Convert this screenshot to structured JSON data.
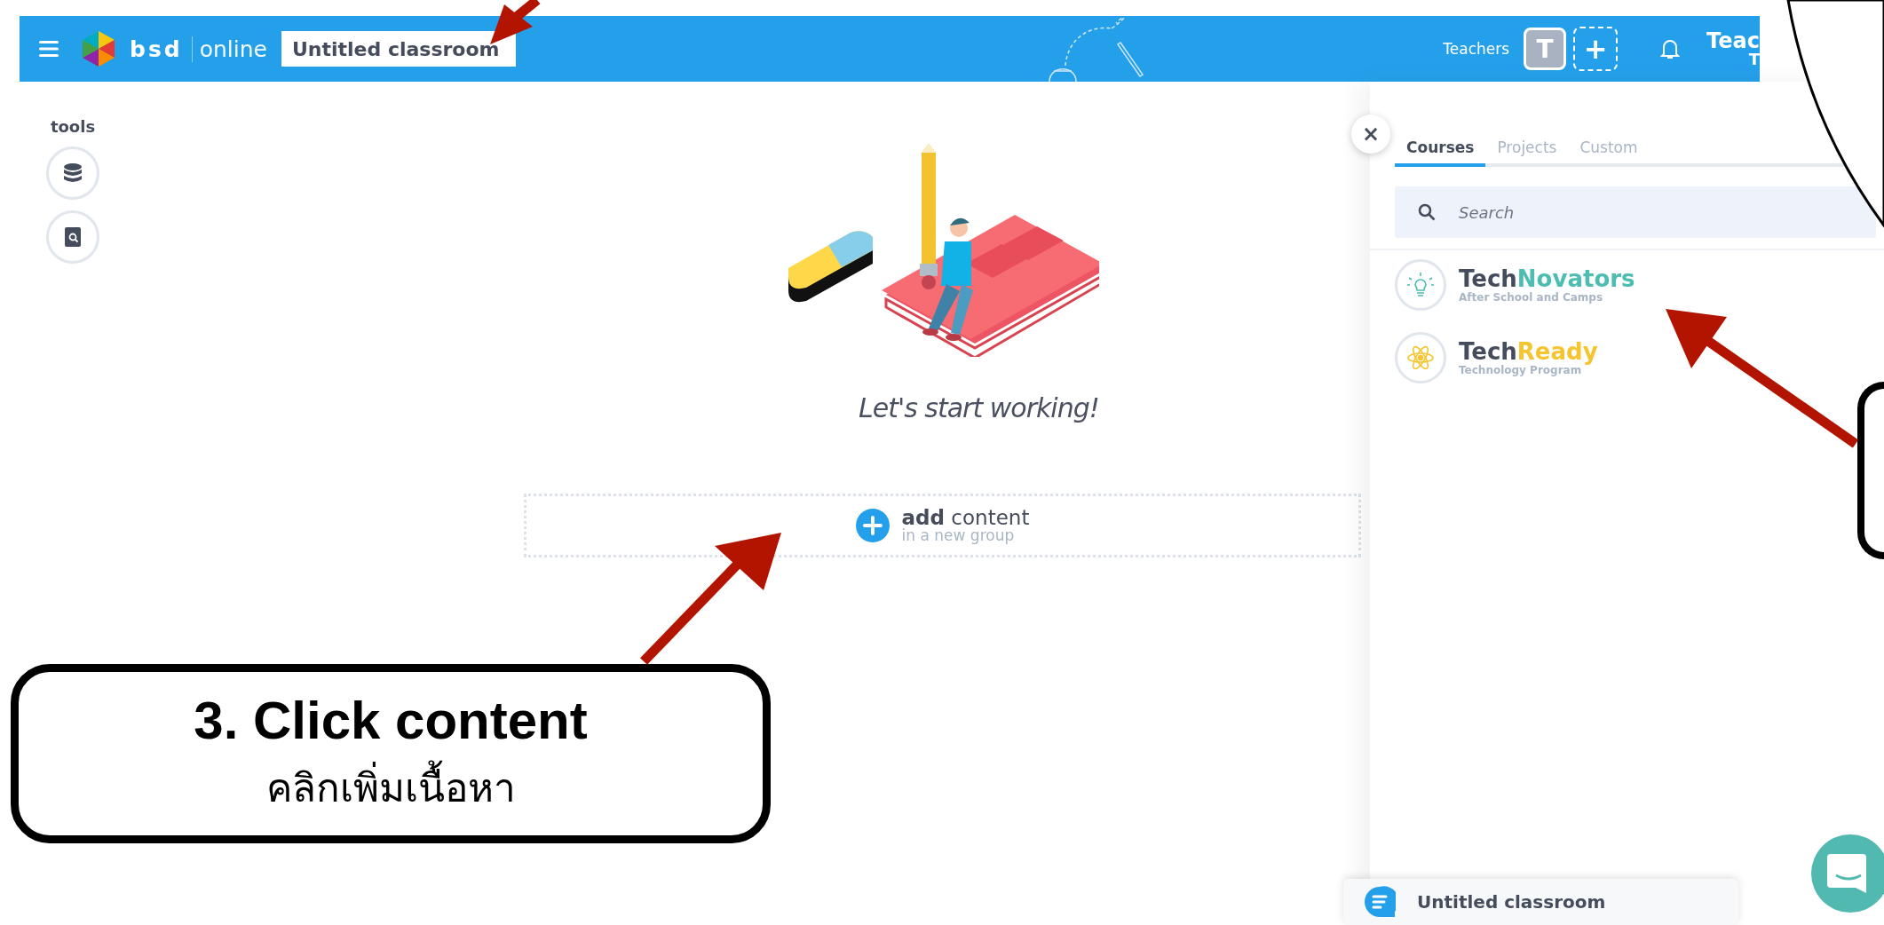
{
  "header": {
    "brand": "bsd",
    "brand_suffix": "online",
    "classroom_title": "Untitled classroom",
    "role_label": "Teachers",
    "avatar_initial": "T",
    "add_symbol": "+",
    "user_name": "Teac",
    "user_sub": "T"
  },
  "tools": {
    "title": "tools"
  },
  "empty_state": {
    "message": "Let's start working!"
  },
  "add_content": {
    "label": "**add** content",
    "sub": "in a new group"
  },
  "panel": {
    "close": "×",
    "tabs": [
      {
        "label": "Courses",
        "selected": true
      },
      {
        "label": "Projects",
        "selected": false
      },
      {
        "label": "Custom",
        "selected": false
      }
    ],
    "search": {
      "placeholder": "Search"
    },
    "courses": [
      {
        "kind": "bulb",
        "name": "Tech",
        "accent": "Novators",
        "color": "#4dbdb2",
        "subtitle": "After School and Camps"
      },
      {
        "kind": "atom",
        "name": "Tech",
        "accent": "Ready",
        "color": "#f5c431",
        "subtitle": "Technology Program"
      }
    ]
  },
  "chat_bar": {
    "title": "Untitled classroom"
  },
  "annotation": {
    "title": "3. Click content",
    "subtitle": "คลิกเพิ่มเนื้อหา"
  }
}
